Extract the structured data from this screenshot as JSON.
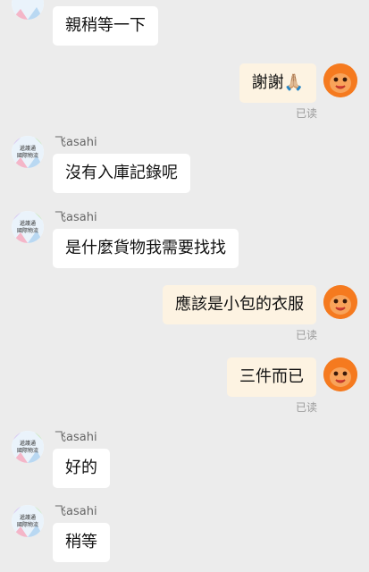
{
  "sender_name": "飞asahi",
  "avatar_logo_text": [
    "遞護通",
    "國際物流"
  ],
  "read_label": "已读",
  "messages": [
    {
      "side": "left",
      "text": "親稍等一下"
    },
    {
      "side": "right",
      "text": "謝謝🙏🏼"
    },
    {
      "side": "left",
      "text": "沒有入庫記錄呢"
    },
    {
      "side": "left",
      "text": "是什麼貨物我需要找找"
    },
    {
      "side": "right",
      "text": "應該是小包的衣服"
    },
    {
      "side": "right",
      "text": "三件而已"
    },
    {
      "side": "left",
      "text": "好的"
    },
    {
      "side": "left",
      "text": "稍等"
    }
  ],
  "colors": {
    "background": "#ececec",
    "left_bubble": "#ffffff",
    "right_bubble": "#fdf3e2",
    "user_avatar": "#f57a1f"
  }
}
